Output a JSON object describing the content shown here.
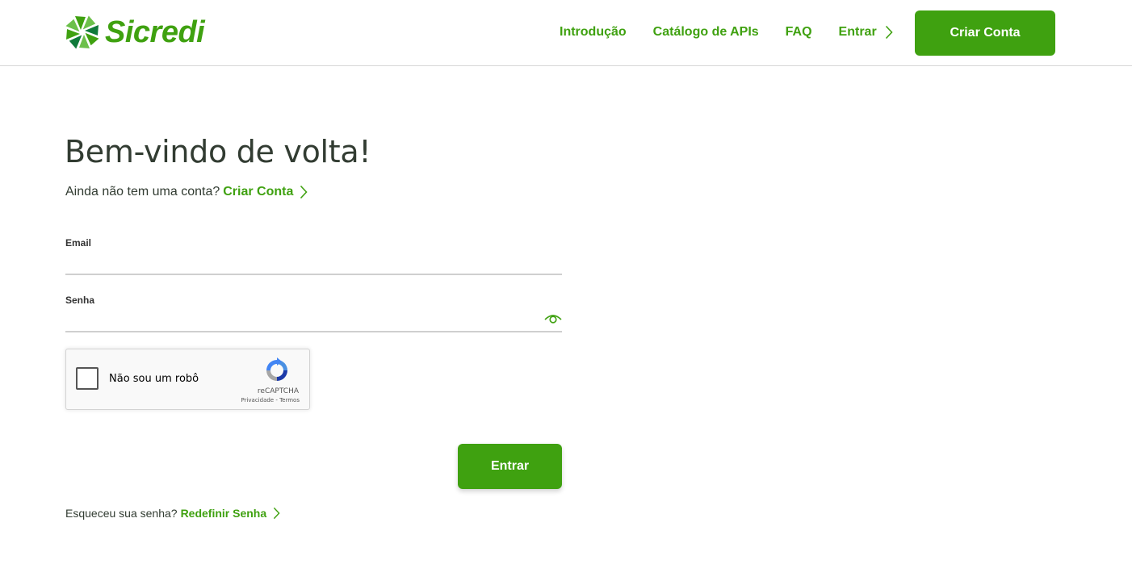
{
  "colors": {
    "brand_green": "#3fa110",
    "dark_text": "#323c32",
    "border": "#cfcfcf"
  },
  "header": {
    "logo_text": "Sicredi",
    "logo_icon": "sicredi-pinwheel-logo",
    "nav": {
      "introducao": "Introdução",
      "catalogo": "Catálogo de APIs",
      "faq": "FAQ",
      "entrar": "Entrar"
    },
    "cta_label": "Criar Conta"
  },
  "main": {
    "title": "Bem-vindo de volta!",
    "no_account_text": "Ainda não tem uma conta?",
    "create_account_link": "Criar Conta",
    "email_label": "Email",
    "email_value": "",
    "password_label": "Senha",
    "password_value": "",
    "password_toggle_icon": "eye-icon",
    "captcha": {
      "label": "Não sou um robô",
      "brand": "reCAPTCHA",
      "terms": "Privacidade - Termos",
      "checked": false
    },
    "submit_label": "Entrar",
    "forgot_text": "Esqueceu sua senha?",
    "reset_link": "Redefinir Senha"
  }
}
